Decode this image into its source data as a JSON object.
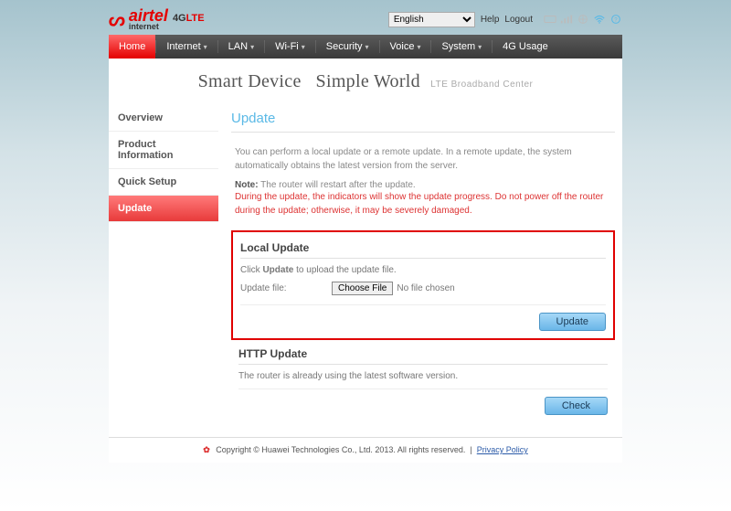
{
  "top": {
    "brand": "airtel",
    "brand_tag": "4GLTE",
    "brand_sub": "internet",
    "language_selected": "English",
    "help": "Help",
    "logout": "Logout"
  },
  "nav": {
    "items": [
      "Home",
      "Internet",
      "LAN",
      "Wi-Fi",
      "Security",
      "Voice",
      "System",
      "4G Usage"
    ],
    "active": "Home"
  },
  "slogan": {
    "a": "Smart Device",
    "b": "Simple World",
    "tag": "LTE  Broadband  Center"
  },
  "sidebar": {
    "items": [
      "Overview",
      "Product Information",
      "Quick Setup",
      "Update"
    ],
    "active": "Update"
  },
  "page": {
    "title": "Update",
    "intro": "You can perform a local update or a remote update. In a remote update, the system automatically obtains the latest version from the server.",
    "note_label": "Note:",
    "note_text": "The router will restart after the update.",
    "warning": "During the update, the indicators will show the update progress. Do not power off the router during the update; otherwise, it may be severely damaged.",
    "local": {
      "heading": "Local Update",
      "hint_pre": "Click ",
      "hint_bold": "Update",
      "hint_post": " to upload the update file.",
      "field_label": "Update file:",
      "choose_label": "Choose File",
      "file_status": "No file chosen",
      "button": "Update"
    },
    "http": {
      "heading": "HTTP Update",
      "status": "The router is already using the latest software version.",
      "button": "Check"
    }
  },
  "footer": {
    "copyright": "Copyright © Huawei Technologies Co., Ltd. 2013. All rights reserved.",
    "privacy": "Privacy Policy"
  }
}
